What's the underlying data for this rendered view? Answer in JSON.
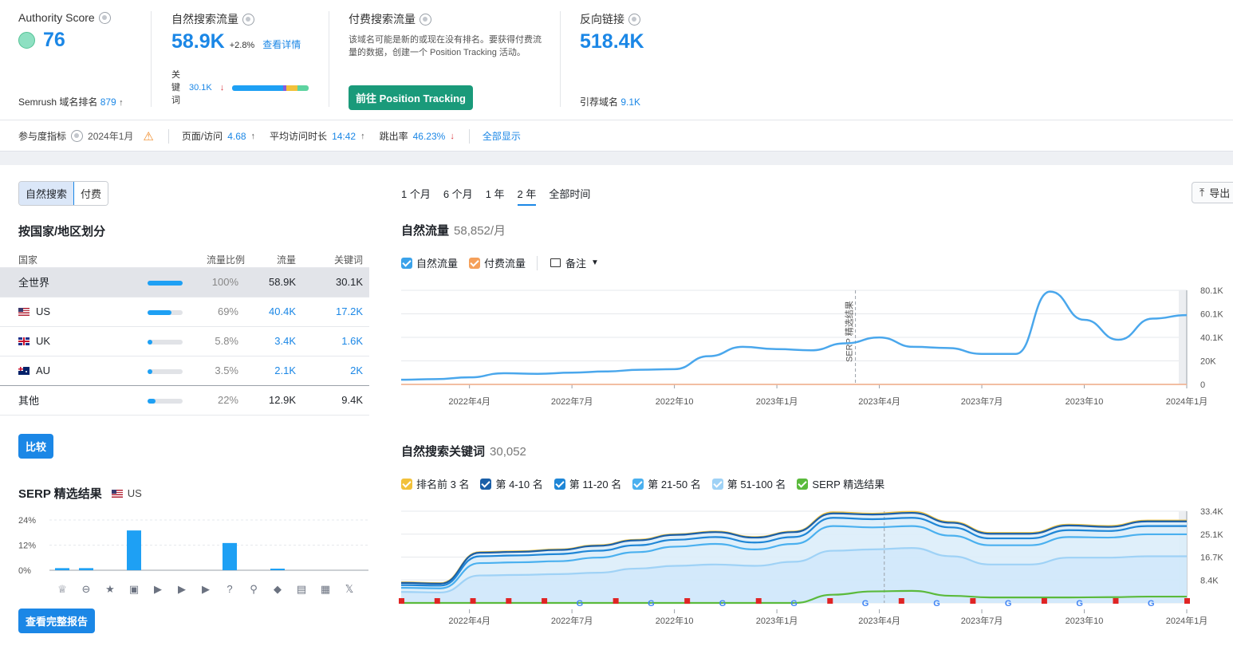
{
  "metrics": {
    "authority": {
      "title": "Authority Score",
      "value": "76",
      "rank_label": "Semrush 域名排名",
      "rank_value": "879"
    },
    "organic": {
      "title": "自然搜索流量",
      "value": "58.9K",
      "change": "+2.8%",
      "details_link": "查看详情",
      "kw_label": "关键词",
      "kw_value": "30.1K"
    },
    "paid": {
      "title": "付费搜索流量",
      "description": "该域名可能是新的或现在没有排名。要获得付费流量的数据，创建一个 Position Tracking 活动。",
      "button": "前往 Position Tracking"
    },
    "backlinks": {
      "title": "反向链接",
      "value": "518.4K",
      "ref_label": "引荐域名",
      "ref_value": "9.1K"
    }
  },
  "engagement": {
    "label": "参与度指标",
    "date": "2024年1月",
    "pages_label": "页面/访问",
    "pages_value": "4.68",
    "duration_label": "平均访问时长",
    "duration_value": "14:42",
    "bounce_label": "跳出率",
    "bounce_value": "46.23%",
    "show_all": "全部显示"
  },
  "tabs": {
    "organic": "自然搜索",
    "paid": "付费"
  },
  "geo": {
    "title": "按国家/地区划分",
    "headers": {
      "country": "国家",
      "share": "流量比例",
      "traffic": "流量",
      "keywords": "关键词"
    },
    "rows": [
      {
        "name": "全世界",
        "share": "100%",
        "share_frac": 1.0,
        "traffic": "58.9K",
        "keywords": "30.1K"
      },
      {
        "name": "US",
        "share": "69%",
        "share_frac": 0.69,
        "traffic": "40.4K",
        "keywords": "17.2K"
      },
      {
        "name": "UK",
        "share": "5.8%",
        "share_frac": 0.058,
        "traffic": "3.4K",
        "keywords": "1.6K"
      },
      {
        "name": "AU",
        "share": "3.5%",
        "share_frac": 0.035,
        "traffic": "2.1K",
        "keywords": "2K"
      },
      {
        "name": "其他",
        "share": "22%",
        "share_frac": 0.22,
        "traffic": "12.9K",
        "keywords": "9.4K"
      }
    ],
    "compare_button": "比较"
  },
  "serp": {
    "title": "SERP 精选结果",
    "country": "US",
    "full_report_button": "查看完整报告"
  },
  "periods": [
    "1 个月",
    "6 个月",
    "1 年",
    "2 年",
    "全部时间"
  ],
  "active_period": "2 年",
  "export_label": "导出",
  "traffic_chart": {
    "title": "自然流量",
    "value": "58,852/月",
    "legend": {
      "organic": "自然流量",
      "paid": "付费流量",
      "notes": "备注"
    },
    "annotation": "SERP 精选结果"
  },
  "keywords_chart": {
    "title": "自然搜索关键词",
    "value": "30,052",
    "legend": [
      "排名前 3 名",
      "第 4-10 名",
      "第 11-20 名",
      "第 21-50 名",
      "第 51-100 名",
      "SERP 精选结果"
    ]
  },
  "chart_data": [
    {
      "type": "bar",
      "title": "SERP 精选结果",
      "y_ticks": [
        "24%",
        "12%",
        "0%"
      ],
      "ylim": [
        0,
        24
      ],
      "categories": [
        "featured-snippet",
        "sitelinks",
        "reviews",
        "image",
        "video",
        "featured-video",
        "people-also-ask-video",
        "faq",
        "local-pack",
        "knowledge-panel",
        "news",
        "jobs",
        "twitter"
      ],
      "values": [
        1,
        1,
        0,
        19,
        0,
        0,
        0,
        13,
        0,
        0.5,
        0,
        0,
        0
      ]
    },
    {
      "type": "line",
      "title": "自然流量",
      "x_ticks": [
        "2022年4月",
        "2022年7月",
        "2022年10",
        "2023年1月",
        "2023年4月",
        "2023年7月",
        "2023年10",
        "2024年1月"
      ],
      "y_ticks": [
        "80.1K",
        "60.1K",
        "40.1K",
        "20K",
        "0"
      ],
      "ylim": [
        0,
        80100
      ],
      "series": [
        {
          "name": "自然流量",
          "color": "#4aa7ec",
          "x": [
            "2022-02",
            "2022-03",
            "2022-04",
            "2022-05",
            "2022-06",
            "2022-07",
            "2022-08",
            "2022-09",
            "2022-10",
            "2022-11",
            "2022-12",
            "2023-01",
            "2023-02",
            "2023-03",
            "2023-04",
            "2023-05",
            "2023-06",
            "2023-07",
            "2023-08",
            "2023-09",
            "2023-10",
            "2023-11",
            "2023-12",
            "2024-01"
          ],
          "y": [
            4000,
            4500,
            6000,
            9500,
            9000,
            10000,
            11000,
            12500,
            13000,
            24000,
            32000,
            30000,
            29000,
            35000,
            40000,
            32000,
            31000,
            26000,
            26000,
            79000,
            55000,
            38000,
            56000,
            59000
          ]
        },
        {
          "name": "付费流量",
          "color": "#f5a05a",
          "x": [
            "2022-02",
            "2024-01"
          ],
          "y": [
            0,
            0
          ]
        }
      ]
    },
    {
      "type": "area",
      "title": "自然搜索关键词",
      "x_ticks": [
        "2022年4月",
        "2022年7月",
        "2022年10",
        "2023年1月",
        "2023年4月",
        "2023年7月",
        "2023年10",
        "2024年1月"
      ],
      "y_ticks": [
        "33.4K",
        "25.1K",
        "16.7K",
        "8.4K",
        "0"
      ],
      "ylim": [
        0,
        33400
      ],
      "x": [
        "2022-02",
        "2022-03",
        "2022-04",
        "2022-05",
        "2022-06",
        "2022-07",
        "2022-08",
        "2022-09",
        "2022-10",
        "2022-11",
        "2022-12",
        "2023-01",
        "2023-02",
        "2023-03",
        "2023-04",
        "2023-05",
        "2023-06",
        "2023-07",
        "2023-08",
        "2023-09",
        "2023-10",
        "2023-11",
        "2023-12",
        "2024-01"
      ],
      "series": [
        {
          "name": "排名前 3 名",
          "color": "#f2c13a",
          "y": [
            7500,
            7200,
            18500,
            18800,
            19500,
            21000,
            23000,
            25000,
            26000,
            24000,
            26000,
            33000,
            32500,
            33200,
            29500,
            25500,
            25500,
            28500,
            28000,
            30000,
            30000
          ]
        },
        {
          "name": "第 4-10 名",
          "color": "#1a5fa8",
          "y": [
            7300,
            7000,
            18300,
            18600,
            19300,
            20800,
            22800,
            24800,
            25800,
            23800,
            25800,
            32600,
            32200,
            32800,
            29200,
            25200,
            25200,
            28200,
            27700,
            29700,
            29700
          ]
        },
        {
          "name": "第 11-20 名",
          "color": "#1f86d6",
          "y": [
            6500,
            6300,
            17000,
            17300,
            17800,
            19000,
            21000,
            23000,
            24000,
            22000,
            24000,
            31000,
            30500,
            31000,
            27500,
            23500,
            23500,
            26500,
            26200,
            28000,
            28000
          ]
        },
        {
          "name": "第 21-50 名",
          "color": "#4ab0ef",
          "y": [
            5500,
            5300,
            14500,
            14800,
            15200,
            16500,
            18500,
            20500,
            21500,
            19500,
            21500,
            28000,
            27500,
            28000,
            24500,
            21000,
            21000,
            24000,
            23800,
            25000,
            25000
          ]
        },
        {
          "name": "第 51-100 名",
          "color": "#9fd2f6",
          "y": [
            4000,
            3800,
            10000,
            10200,
            10500,
            11000,
            12500,
            13500,
            14000,
            13500,
            15000,
            19000,
            19500,
            20000,
            17000,
            14000,
            14000,
            16500,
            16500,
            17000,
            17000
          ]
        },
        {
          "name": "SERP 精选结果",
          "color": "#5bba3c",
          "y": [
            0,
            0,
            0,
            0,
            0,
            0,
            0,
            0,
            0,
            0,
            0,
            3000,
            4200,
            4400,
            2600,
            2000,
            2000,
            2000,
            2100,
            2300,
            2300
          ]
        }
      ]
    }
  ]
}
